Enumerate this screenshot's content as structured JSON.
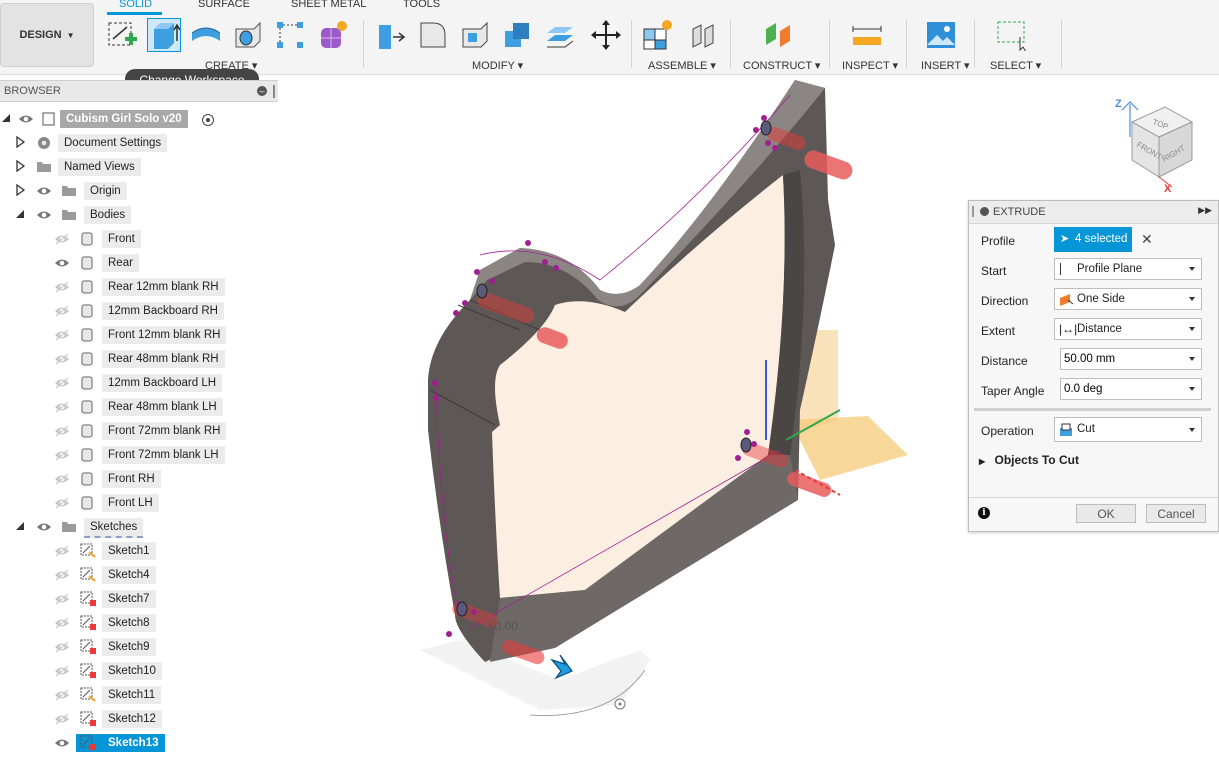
{
  "toolbar": {
    "workspace_label": "DESIGN",
    "tabs": [
      "SOLID",
      "SURFACE",
      "SHEET METAL",
      "TOOLS"
    ],
    "groups": {
      "create": "CREATE",
      "modify": "MODIFY",
      "assemble": "ASSEMBLE",
      "construct": "CONSTRUCT",
      "inspect": "INSPECT",
      "insert": "INSERT",
      "select": "SELECT"
    },
    "tooltip": "Change Workspace"
  },
  "browser": {
    "title": "BROWSER",
    "root": "Cubism Girl Solo v20",
    "nodes": {
      "document_settings": "Document Settings",
      "named_views": "Named Views",
      "origin": "Origin",
      "bodies": "Bodies",
      "sketches": "Sketches"
    },
    "bodies": [
      "Front",
      "Rear",
      "Rear 12mm blank RH",
      "12mm Backboard RH",
      "Front 12mm blank RH",
      "Rear 48mm blank RH",
      "12mm Backboard LH",
      "Rear 48mm blank LH",
      "Front  72mm blank RH",
      "Front  72mm blank LH",
      "Front RH",
      "Front LH"
    ],
    "sketches": [
      "Sketch1",
      "Sketch4",
      "Sketch7",
      "Sketch8",
      "Sketch9",
      "Sketch10",
      "Sketch11",
      "Sketch12",
      "Sketch13"
    ]
  },
  "viewcube": {
    "top": "TOP",
    "front": "FRONT",
    "right": "RIGHT",
    "z": "Z",
    "x": "X"
  },
  "viewport": {
    "dimension_label": "50.00"
  },
  "extrude": {
    "title": "EXTRUDE",
    "profile_label": "Profile",
    "profile_value": "4 selected",
    "start_label": "Start",
    "start_value": "Profile Plane",
    "direction_label": "Direction",
    "direction_value": "One Side",
    "extent_label": "Extent",
    "extent_value": "Distance",
    "distance_label": "Distance",
    "distance_value": "50.00 mm",
    "taper_label": "Taper Angle",
    "taper_value": "0.0 deg",
    "operation_label": "Operation",
    "operation_value": "Cut",
    "objects_label": "Objects To Cut",
    "ok": "OK",
    "cancel": "Cancel"
  },
  "colors": {
    "accent": "#0696d7",
    "body": "#6b6663",
    "face": "#fcefe2",
    "cut_marker": "#e83a3a",
    "constraint": "#a02090"
  }
}
